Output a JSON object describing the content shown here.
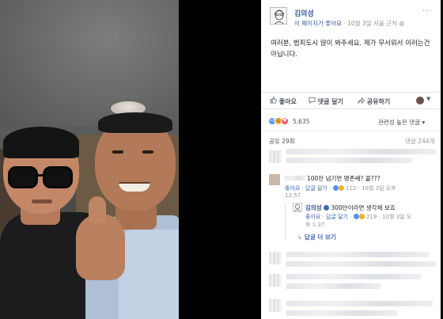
{
  "post": {
    "page_name": "김의성",
    "page_liked_text": "이 페이지가 좋아요",
    "separator": "·",
    "timestamp": "10월 3일 서울 근처",
    "more": "···",
    "body": "여러분, 범죄도시 많이 봐주세요. 제가 무서워서 이러는건 아닙니다."
  },
  "actions": {
    "like": "좋아요",
    "comment": "댓글 달기",
    "share": "공유하기"
  },
  "reactions": {
    "count": "5,635",
    "sort": "관련성 높은 댓글 ▾"
  },
  "counts": {
    "shares": "공유 29회",
    "comments": "댓글 244개"
  },
  "comments": [
    {
      "text": "100만 넘기면 명존쎄? 콜???",
      "like": "좋아요",
      "reply": "답글 달기",
      "reactions": "112",
      "time": "10월 3일 오후",
      "time2": "12:57"
    }
  ],
  "reply": {
    "author": "김의성",
    "text": "300만이라면 생각해 보죠",
    "like": "좋아요",
    "reply": "답글 달기",
    "reactions": "219",
    "time": "10월 3일 오",
    "time2": "후 1:37",
    "more_replies": "답글 더 보기",
    "more_arrow": "↳"
  },
  "colors": {
    "link": "#365899",
    "accent": "#4267b2",
    "muted": "#90949c"
  },
  "icons": {
    "like": "thumbs-up-icon",
    "comment": "speech-bubble-icon",
    "share": "share-arrow-icon"
  }
}
